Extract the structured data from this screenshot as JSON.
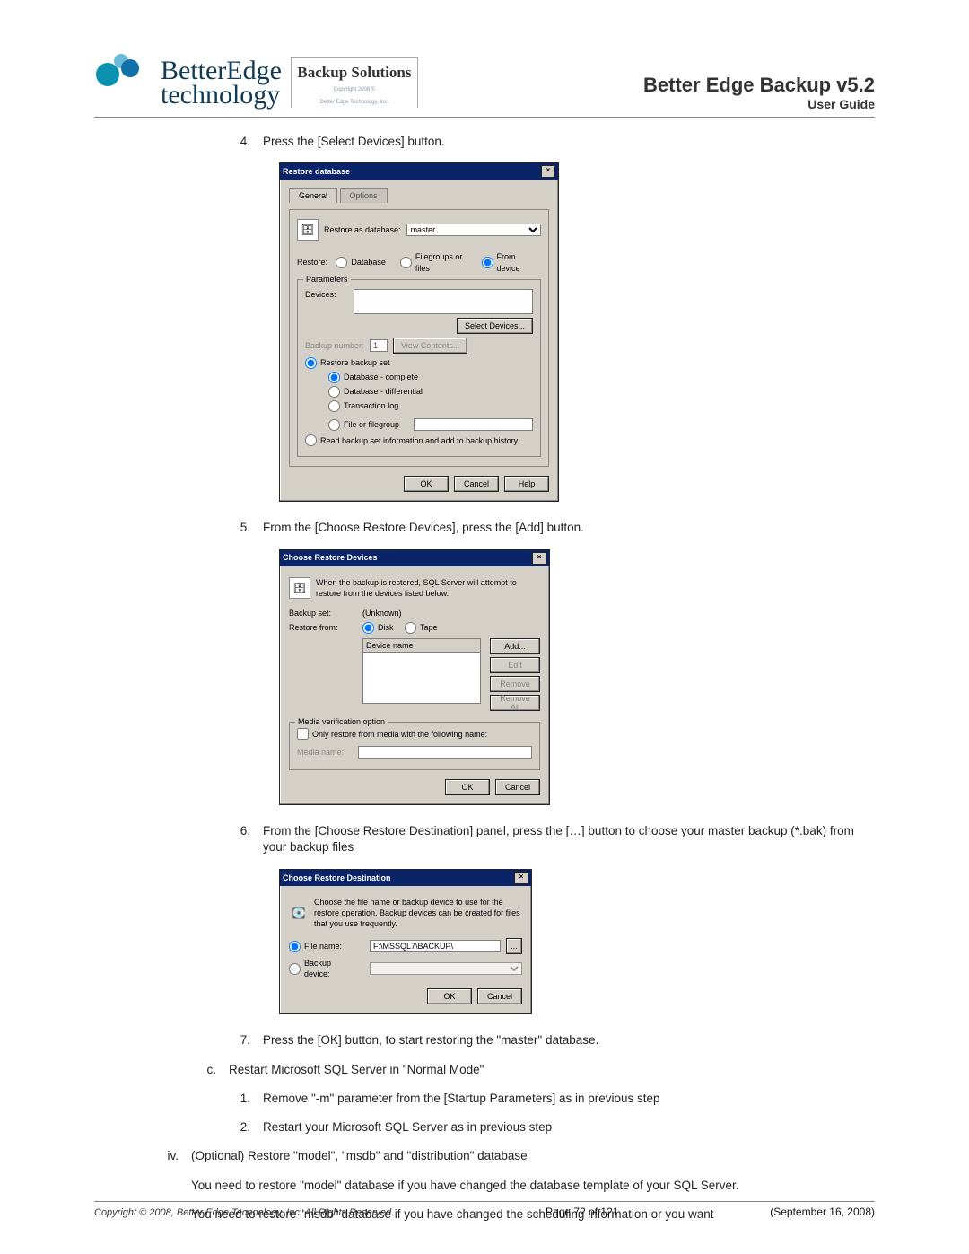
{
  "header": {
    "product": "Better Edge Backup v5.2",
    "subtitle": "User Guide",
    "logo_main": "BetterEdge",
    "logo_sub": "technology",
    "bs_title": "Backup Solutions",
    "bs_line1": "Copyright 2008 ©",
    "bs_line2": "Better Edge Technology, Inc."
  },
  "steps": {
    "s4": "Press the [Select Devices] button.",
    "s5": "From the [Choose Restore Devices], press the [Add] button.",
    "s6": "From the [Choose Restore Destination] panel, press the […] button to choose your master backup (*.bak) from your backup files",
    "s7": "Press the [OK] button, to start restoring the \"master\" database.",
    "c": "Restart Microsoft SQL Server in \"Normal Mode\"",
    "c1": "Remove \"-m\" parameter from the [Startup Parameters] as in previous step",
    "c2": "Restart your Microsoft SQL Server as in previous step",
    "iv": "(Optional) Restore \"model\", \"msdb\" and \"distribution\" database",
    "iv_p1": "You need to restore \"model\" database if you have changed the database template of your SQL Server.",
    "iv_p2": "You need to restore \"msdb\" database if you have changed the scheduling information or you want"
  },
  "dlg1": {
    "title": "Restore database",
    "tab_general": "General",
    "tab_options": "Options",
    "restore_as_db": "Restore as database:",
    "db_value": "master",
    "restore_lbl": "Restore:",
    "r_database": "Database",
    "r_filegroups": "Filegroups or files",
    "r_fromdevice": "From device",
    "parameters": "Parameters",
    "devices": "Devices:",
    "select_devices": "Select Devices...",
    "backup_no": "Backup number:",
    "view_contents": "View Contents...",
    "restore_backup_set": "Restore backup set",
    "db_complete": "Database - complete",
    "db_diff": "Database - differential",
    "tlog": "Transaction log",
    "file_fg": "File or filegroup",
    "read_history": "Read backup set information and add to backup history",
    "ok": "OK",
    "cancel": "Cancel",
    "help": "Help"
  },
  "dlg2": {
    "title": "Choose Restore Devices",
    "intro": "When the backup is restored, SQL Server will attempt to restore from the devices listed below.",
    "backup_set": "Backup set:",
    "unknown": "(Unknown)",
    "restore_from": "Restore from:",
    "disk": "Disk",
    "tape": "Tape",
    "device_name": "Device name",
    "add": "Add...",
    "edit": "Edit",
    "remove": "Remove",
    "remove_all": "Remove All",
    "media_opt": "Media verification option",
    "only_restore": "Only restore from media with the following name:",
    "media_name": "Media name:",
    "ok": "OK",
    "cancel": "Cancel"
  },
  "dlg3": {
    "title": "Choose Restore Destination",
    "intro": "Choose the file name or backup device to use for the restore operation. Backup devices can be created for files that you use frequently.",
    "file_name": "File name:",
    "file_value": "F:\\MSSQL7\\BACKUP\\",
    "backup_device": "Backup device:",
    "browse": "...",
    "ok": "OK",
    "cancel": "Cancel"
  },
  "footer": {
    "copy": "Copyright © 2008, Better Edge Technology, Inc.   All Rights Reserved.",
    "page": "Page 72 of 121",
    "date": "(September 16, 2008)"
  }
}
